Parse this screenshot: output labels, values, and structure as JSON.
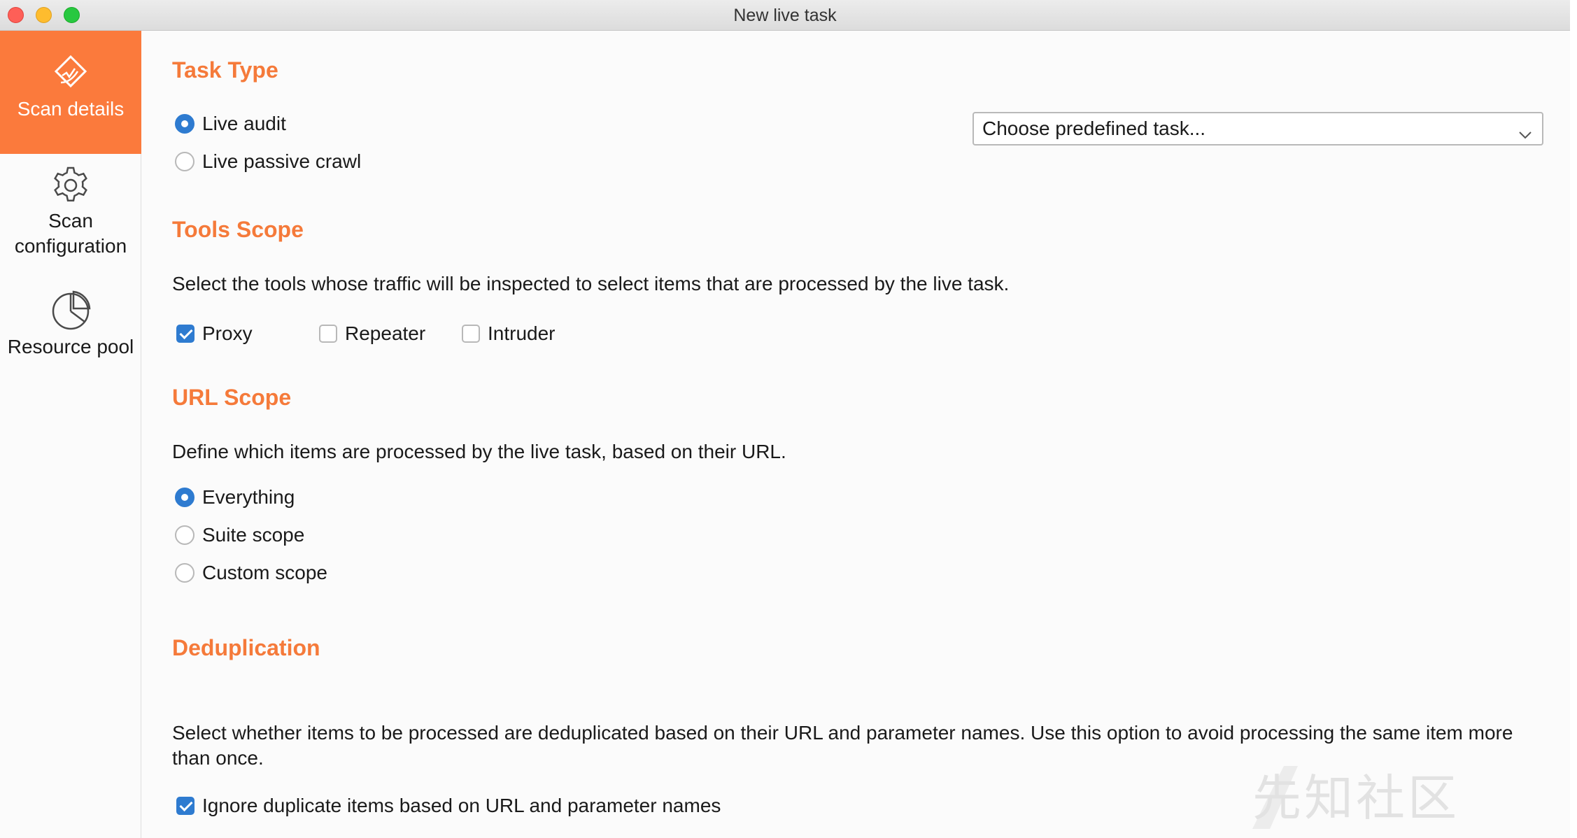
{
  "window": {
    "title": "New live task"
  },
  "sidebar": {
    "items": [
      {
        "label": "Scan details",
        "icon": "radar-icon",
        "active": true
      },
      {
        "label": "Scan configuration",
        "icon": "gear-icon",
        "active": false
      },
      {
        "label": "Resource pool",
        "icon": "pie-chart-icon",
        "active": false
      }
    ]
  },
  "task_type": {
    "title": "Task Type",
    "options": [
      "Live audit",
      "Live passive crawl"
    ],
    "selected": "Live audit",
    "predefined_select": {
      "value": "Choose predefined task..."
    }
  },
  "tools_scope": {
    "title": "Tools Scope",
    "description": "Select the tools whose traffic will be inspected to select items that are processed by the live task.",
    "tools": [
      {
        "label": "Proxy",
        "checked": true
      },
      {
        "label": "Repeater",
        "checked": false
      },
      {
        "label": "Intruder",
        "checked": false
      }
    ]
  },
  "url_scope": {
    "title": "URL Scope",
    "description": "Define which items are processed by the live task, based on their URL.",
    "options": [
      "Everything",
      "Suite scope",
      "Custom scope"
    ],
    "selected": "Everything"
  },
  "deduplication": {
    "title": "Deduplication",
    "description": "Select whether items to be processed are deduplicated based on their URL and parameter names. Use this option to avoid processing the same item more than once.",
    "option": {
      "label": "Ignore duplicate items based on URL and parameter names",
      "checked": true
    }
  },
  "watermark": {
    "text": "先知社区"
  },
  "colors": {
    "accent": "#fb7a3c",
    "section_title": "#f57a3a",
    "control_blue": "#2e7bd0"
  }
}
